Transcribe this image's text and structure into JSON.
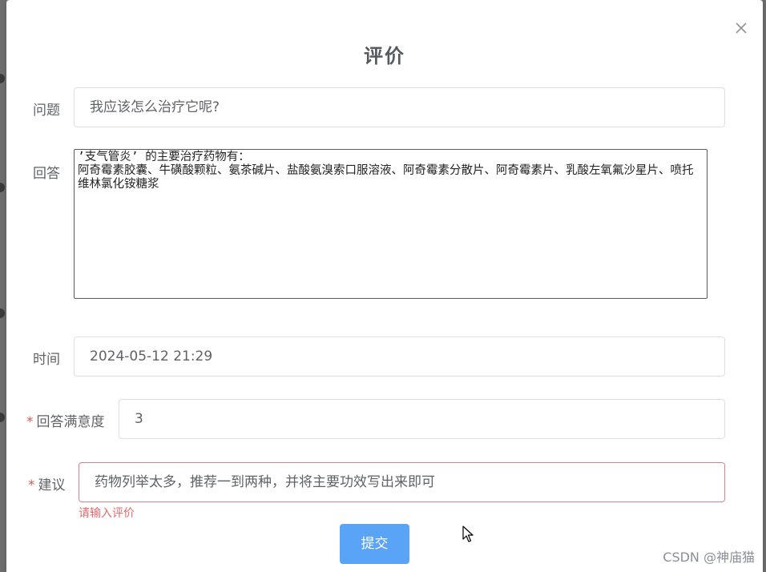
{
  "dialog": {
    "title": "评价",
    "close_icon": "close-icon"
  },
  "form": {
    "question": {
      "label": "问题",
      "value": "我应该怎么治疗它呢?"
    },
    "answer": {
      "label": "回答",
      "value": "’支气管炎’ 的主要治疗药物有：\n阿奇霉素胶囊、牛磺酸颗粒、氨茶碱片、盐酸氨溴索口服溶液、阿奇霉素分散片、阿奇霉素片、乳酸左氧氟沙星片、喷托维林氯化铵糖浆"
    },
    "time": {
      "label": "时间",
      "value": "2024-05-12 21:29"
    },
    "satisfaction": {
      "required_mark": "*",
      "label": "回答满意度",
      "value": "3"
    },
    "suggestion": {
      "required_mark": "*",
      "label": "建议",
      "value": "药物列举太多，推荐一到两种，并将主要功效写出来即可",
      "error": "请输入评价"
    },
    "submit_label": "提交"
  },
  "watermark": "CSDN @神庙猫",
  "colors": {
    "primary": "#5aa4f8",
    "error": "#e36a6a"
  }
}
